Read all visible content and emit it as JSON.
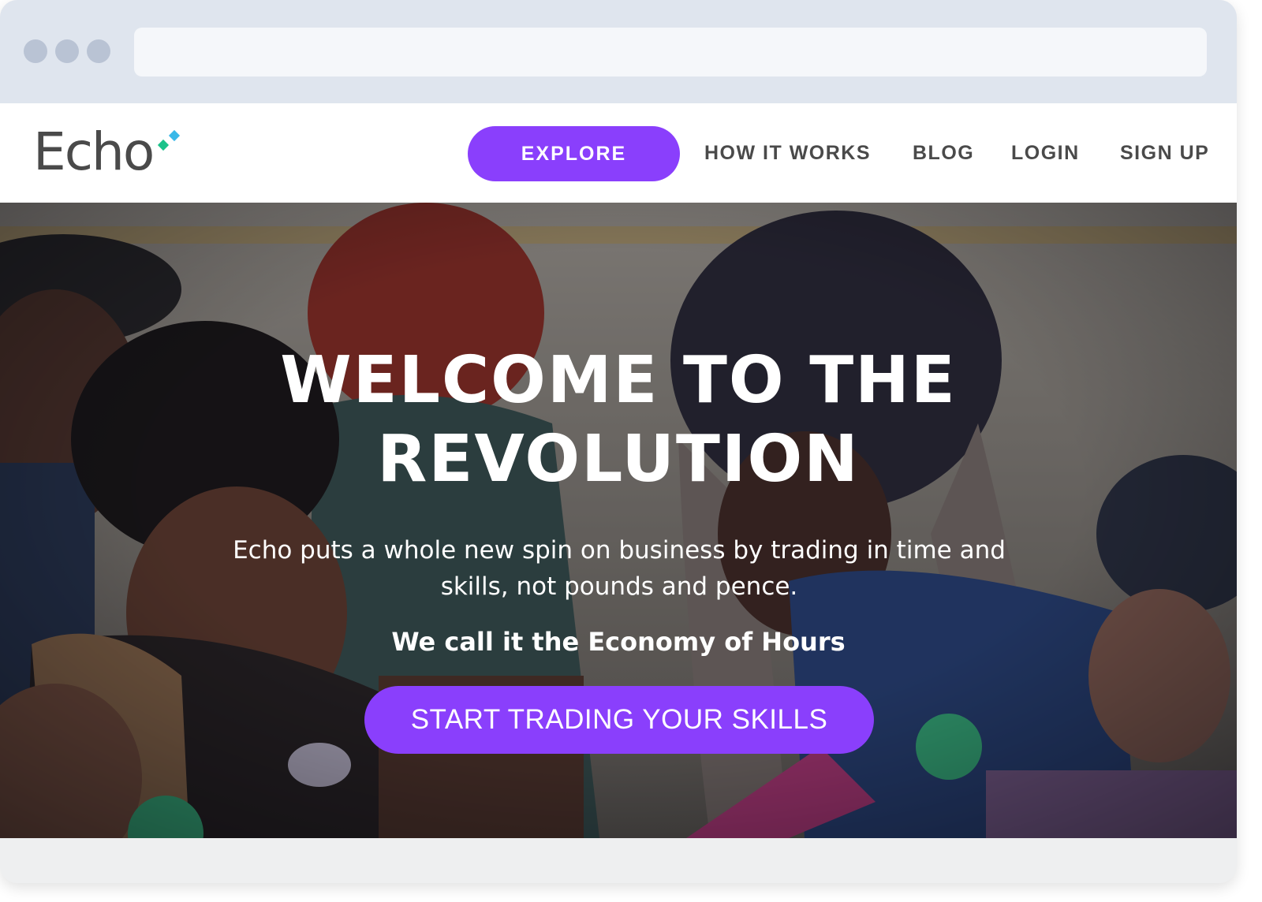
{
  "browser": {
    "address_value": ""
  },
  "header": {
    "logo_text": "Echo",
    "nav": {
      "explore": "EXPLORE",
      "how_it_works": "HOW IT WORKS",
      "blog": "BLOG",
      "login": "LOGIN",
      "sign_up": "SIGN UP"
    }
  },
  "hero": {
    "title_line1": "WELCOME TO THE",
    "title_line2": "REVOLUTION",
    "description": "Echo puts a whole new spin on business by trading in time and skills, not pounds and pence.",
    "tagline": "We call it the Economy of Hours",
    "cta": "START TRADING YOUR SKILLS"
  },
  "colors": {
    "accent": "#8a3ffc",
    "chrome": "#dfe5ee",
    "nav_text": "#4a4a4a",
    "logo_green": "#1cc28a",
    "logo_blue": "#38b8e8"
  }
}
